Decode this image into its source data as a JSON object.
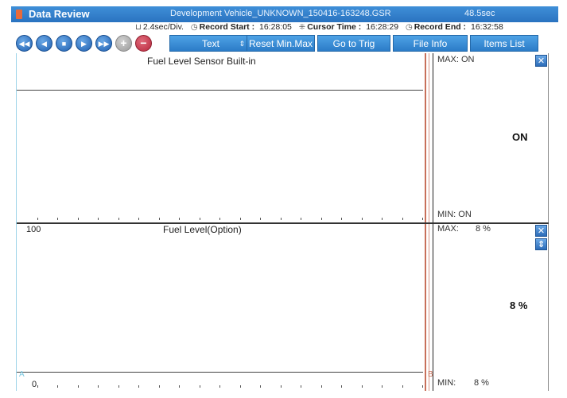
{
  "titlebar": {
    "app_title": "Data Review",
    "file_name": "Development Vehicle_UNKNOWN_150416-163248.GSR",
    "duration": "48.5sec"
  },
  "info": {
    "div_label": "2.4sec/Div.",
    "record_start_label": "Record Start :",
    "record_start_value": "16:28:05",
    "cursor_time_label": "Cursor Time :",
    "cursor_time_value": "16:28:29",
    "record_end_label": "Record End :",
    "record_end_value": "16:32:58"
  },
  "toolbar": {
    "rewind_icon": "◀◀",
    "prev_icon": "◀",
    "stop_icon": "■",
    "play_icon": "▶",
    "fast_forward_icon": "▶▶",
    "plus_icon": "+",
    "minus_icon": "−",
    "view_select": "Text",
    "view_updown": "⇕",
    "reset_label": "Reset Min.Max",
    "goto_trig_label": "Go to Trig",
    "file_info_label": "File Info",
    "items_list_label": "Items List"
  },
  "panels": [
    {
      "title": "Fuel Level Sensor Built-in",
      "max_label": "MAX: ON",
      "min_label": "MIN: ON",
      "current_value": "ON",
      "close_icon": "✕"
    },
    {
      "title": "Fuel Level(Option)",
      "axis_top": "100",
      "axis_bottom": "0",
      "max_label": "MAX:",
      "max_value": "8 %",
      "min_label": "MIN:",
      "min_value": "8 %",
      "current_value": "8 %",
      "close_icon": "✕",
      "order_icon": "⇕",
      "marker_a": "A",
      "marker_b": "B"
    }
  ]
}
